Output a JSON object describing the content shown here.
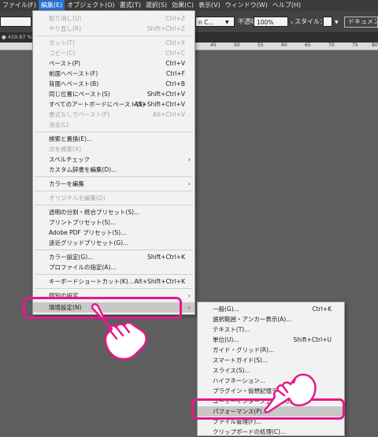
{
  "menubar": {
    "items": [
      "ファイル(F)",
      "編集(E)",
      "オブジェクト(O)",
      "書式(T)",
      "選択(S)",
      "効果(C)",
      "表示(V)",
      "ウィンドウ(W)",
      "ヘルプ(H)"
    ]
  },
  "controlbar": {
    "style_field_fragment": "n C...",
    "opacity_label": "不透明度：",
    "opacity_value": "100%",
    "style_label": "スタイル：",
    "document_button": "ドキュメン"
  },
  "tabbar": {
    "tab_label": "● 419.87 %"
  },
  "ruler": {
    "ticks": [
      "45",
      "50",
      "55",
      "60",
      "65",
      "70",
      "75",
      "80"
    ]
  },
  "edit_menu": {
    "items": [
      {
        "label": "取り消し(U)",
        "shortcut": "Ctrl+Z",
        "disabled": true
      },
      {
        "label": "やり直し(R)",
        "shortcut": "Shift+Ctrl+Z",
        "disabled": true
      },
      {
        "label": "カット(T)",
        "shortcut": "Ctrl+X",
        "disabled": true
      },
      {
        "label": "コピー(C)",
        "shortcut": "Ctrl+C",
        "disabled": true
      },
      {
        "label": "ペースト(P)",
        "shortcut": "Ctrl+V"
      },
      {
        "label": "前面へペースト(F)",
        "shortcut": "Ctrl+F"
      },
      {
        "label": "背面へペースト(B)",
        "shortcut": "Ctrl+B"
      },
      {
        "label": "同じ位置にペースト(S)",
        "shortcut": "Shift+Ctrl+V"
      },
      {
        "label": "すべてのアートボードにペースト(S)",
        "shortcut": "Alt+Shift+Ctrl+V"
      },
      {
        "label": "書式なしでペースト(F)",
        "shortcut": "Alt+Ctrl+V",
        "disabled": true
      },
      {
        "label": "消去(L)",
        "shortcut": "",
        "disabled": true
      },
      {
        "label": "検索と置換(E)...",
        "shortcut": ""
      },
      {
        "label": "次を検索(X)",
        "shortcut": "",
        "disabled": true
      },
      {
        "label": "スペルチェック",
        "shortcut": "",
        "submenu": true
      },
      {
        "label": "カスタム辞書を編集(D)...",
        "shortcut": ""
      },
      {
        "label": "カラーを編集",
        "shortcut": "",
        "submenu": true
      },
      {
        "label": "オリジナルを編集(O)",
        "shortcut": "",
        "disabled": true
      },
      {
        "label": "透明の分割・統合プリセット(S)...",
        "shortcut": ""
      },
      {
        "label": "プリントプリセット(S)...",
        "shortcut": ""
      },
      {
        "label": "Adobe PDF プリセット(S)...",
        "shortcut": ""
      },
      {
        "label": "遠近グリッドプリセット(G)...",
        "shortcut": ""
      },
      {
        "label": "カラー設定(G)...",
        "shortcut": "Shift+Ctrl+K"
      },
      {
        "label": "プロファイルの指定(A)...",
        "shortcut": ""
      },
      {
        "label": "キーボードショートカット(K)...",
        "shortcut": "Alt+Shift+Ctrl+K"
      },
      {
        "label": "個別の設定",
        "shortcut": "",
        "submenu": true
      },
      {
        "label": "環境設定(N)",
        "shortcut": "",
        "submenu": true,
        "highlighted": true
      }
    ]
  },
  "preferences_submenu": {
    "items": [
      {
        "label": "一般(G)...",
        "shortcut": "Ctrl+K"
      },
      {
        "label": "選択範囲・アンカー表示(A)...",
        "shortcut": ""
      },
      {
        "label": "テキスト(T)...",
        "shortcut": ""
      },
      {
        "label": "単位(U)...",
        "shortcut": "Shift+Ctrl+U"
      },
      {
        "label": "ガイド・グリッド(R)...",
        "shortcut": ""
      },
      {
        "label": "スマートガイド(S)...",
        "shortcut": ""
      },
      {
        "label": "スライス(S)...",
        "shortcut": ""
      },
      {
        "label": "ハイフネーション...",
        "shortcut": ""
      },
      {
        "label": "プラグイン・仮想記憶ディスク(P)...",
        "shortcut": ""
      },
      {
        "label": "ユーザーインターフェイス(I)...",
        "shortcut": ""
      },
      {
        "label": "パフォーマンス(P)...",
        "shortcut": ""
      },
      {
        "label": "ファイル管理(F)...",
        "shortcut": ""
      },
      {
        "label": "クリップボードの処理(C)...",
        "shortcut": ""
      }
    ]
  },
  "colors": {
    "annotation": "#e8178a",
    "hand_fill": "#ffffff"
  }
}
